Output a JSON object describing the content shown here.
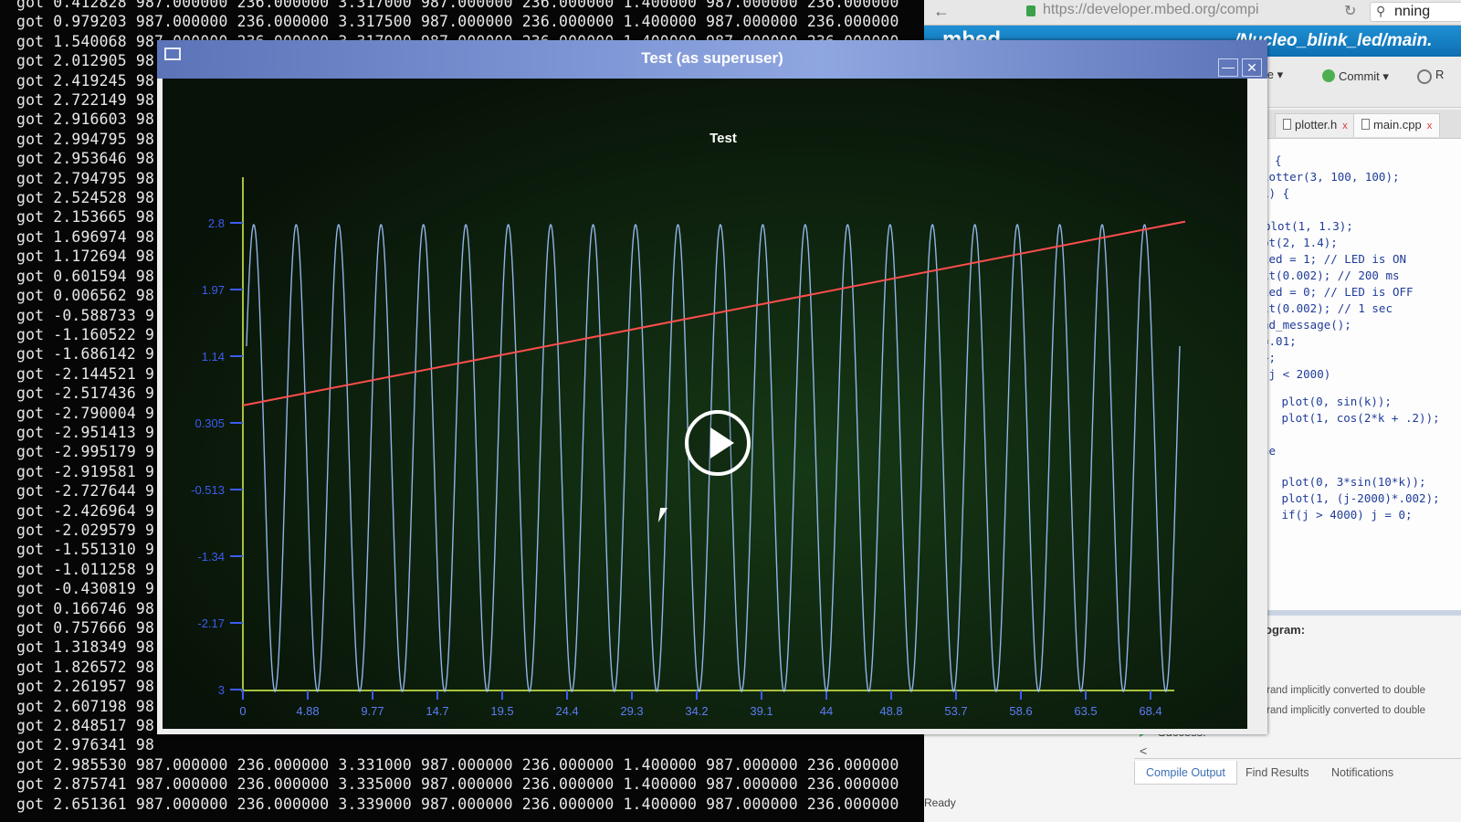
{
  "terminal": {
    "lines": [
      "got 0.412828 987.000000 236.000000 3.317000 987.000000 236.000000 1.400000 987.000000 236.000000",
      "got 0.979203 987.000000 236.000000 3.317500 987.000000 236.000000 1.400000 987.000000 236.000000",
      "got 1.540068 987.000000 236.000000 3.317900 987.000000 236.000000 1.400000 987.000000 236.000000",
      "got 2.012905 98",
      "got 2.419245 98",
      "got 2.722149 98",
      "got 2.916603 98",
      "got 2.994795 98",
      "got 2.953646 98",
      "got 2.794795 98",
      "got 2.524528 98",
      "got 2.153665 98",
      "got 1.696974 98",
      "got 1.172694 98",
      "got 0.601594 98",
      "got 0.006562 98",
      "got -0.588733 9",
      "got -1.160522 9",
      "got -1.686142 9",
      "got -2.144521 9",
      "got -2.517436 9",
      "got -2.790004 9",
      "got -2.951413 9",
      "got -2.995179 9",
      "got -2.919581 9",
      "got -2.727644 9",
      "got -2.426964 9",
      "got -2.029579 9",
      "got -1.551310 9",
      "got -1.011258 9",
      "got -0.430819 9",
      "got 0.166746 98",
      "got 0.757666 98",
      "got 1.318349 98",
      "got 1.826572 98",
      "got 2.261957 98",
      "got 2.607198 98",
      "got 2.848517 98",
      "got 2.976341 98",
      "got 2.985530 987.000000 236.000000 3.331000 987.000000 236.000000 1.400000 987.000000 236.000000",
      "got 2.875741 987.000000 236.000000 3.335000 987.000000 236.000000 1.400000 987.000000 236.000000",
      "got 2.651361 987.000000 236.000000 3.339000 987.000000 236.000000 1.400000 987.000000 236.000000"
    ]
  },
  "browser": {
    "url": "https://developer.mbed.org/compi",
    "search_text": "nning",
    "logo": "mbed",
    "path": "/Nucleo_blink_led/main.",
    "toolbar": {
      "file_label": "ile",
      "commit_label": "Commit",
      "revision_label": "R"
    },
    "tabs": [
      {
        "label": "plotter.h",
        "close": "x"
      },
      {
        "label": "main.cpp",
        "close": "x"
      }
    ],
    "code_lines": [
      {
        "text": "{",
        "comment": false
      },
      {
        "text": "lotter(3, 100, 100);",
        "comment": false
      },
      {
        "text": "1) {",
        "comment": false
      },
      {
        "text": "plot(1, 1.3);",
        "comment": false
      },
      {
        "text": "ot(2, 1.4);",
        "comment": false
      },
      {
        "text": "led = 1; // LED is ON",
        "comment": false
      },
      {
        "text": "it(0.002); // 200 ms",
        "comment": false
      },
      {
        "text": "led = 0; // LED is OFF",
        "comment": false
      },
      {
        "text": "it(0.002); // 1 sec",
        "comment": false
      },
      {
        "text": "nd_message();",
        "comment": false
      },
      {
        "text": "=.01;",
        "comment": false
      },
      {
        "text": "+;",
        "comment": false
      },
      {
        "text": "(j < 2000)",
        "comment": false
      },
      {
        "text": " plot(0, sin(k));",
        "comment": false
      },
      {
        "text": " plot(1, cos(2*k + .2));",
        "comment": false
      },
      {
        "text": "se",
        "comment": false
      },
      {
        "text": " plot(0, 3*sin(10*k));",
        "comment": false
      },
      {
        "text": " plot(1, (j-2000)*.002);",
        "comment": false
      },
      {
        "text": " if(j > 4000) j = 0;",
        "comment": false
      }
    ],
    "bottom": {
      "program_label": "program:",
      "warning1": "operand implicitly converted to double",
      "warning2": "operand implicitly converted to double",
      "success": "Success!",
      "scroll_left": "<",
      "output_tabs": [
        "Compile Output",
        "Find Results",
        "Notifications"
      ],
      "status": "Ready"
    }
  },
  "plot_window": {
    "title": "Test (as superuser)",
    "minimize_symbol": "—",
    "close_symbol": "✕",
    "icons": {
      "menu": "window-menu-icon",
      "play": "play-icon",
      "cursor": "mouse-pointer-icon"
    }
  },
  "chart_data": {
    "type": "line",
    "title": "Test",
    "xlabel": "",
    "ylabel": "",
    "x_ticks": [
      "0",
      "4.88",
      "9.77",
      "14.7",
      "19.5",
      "24.4",
      "29.3",
      "34.2",
      "39.1",
      "44",
      "48.8",
      "53.7",
      "58.6",
      "63.5",
      "68.4"
    ],
    "y_ticks": [
      "2.8",
      "1.97",
      "1.14",
      "0.305",
      "-0.513",
      "-1.34",
      "-2.17",
      "3"
    ],
    "xlim": [
      0,
      72.5
    ],
    "ylim": [
      -3,
      3
    ],
    "grid": false,
    "series": [
      {
        "function": "3*sin(10*k)",
        "amplitude": 3,
        "cycles": 22,
        "color": "#9ec4ff"
      },
      {
        "function": "(j-2000)*.002",
        "start": 0.4,
        "end": 2.6,
        "color": "#ff4d4d"
      }
    ],
    "axis_color": "#a8c23a",
    "tick_color": "#3c5cf0"
  }
}
